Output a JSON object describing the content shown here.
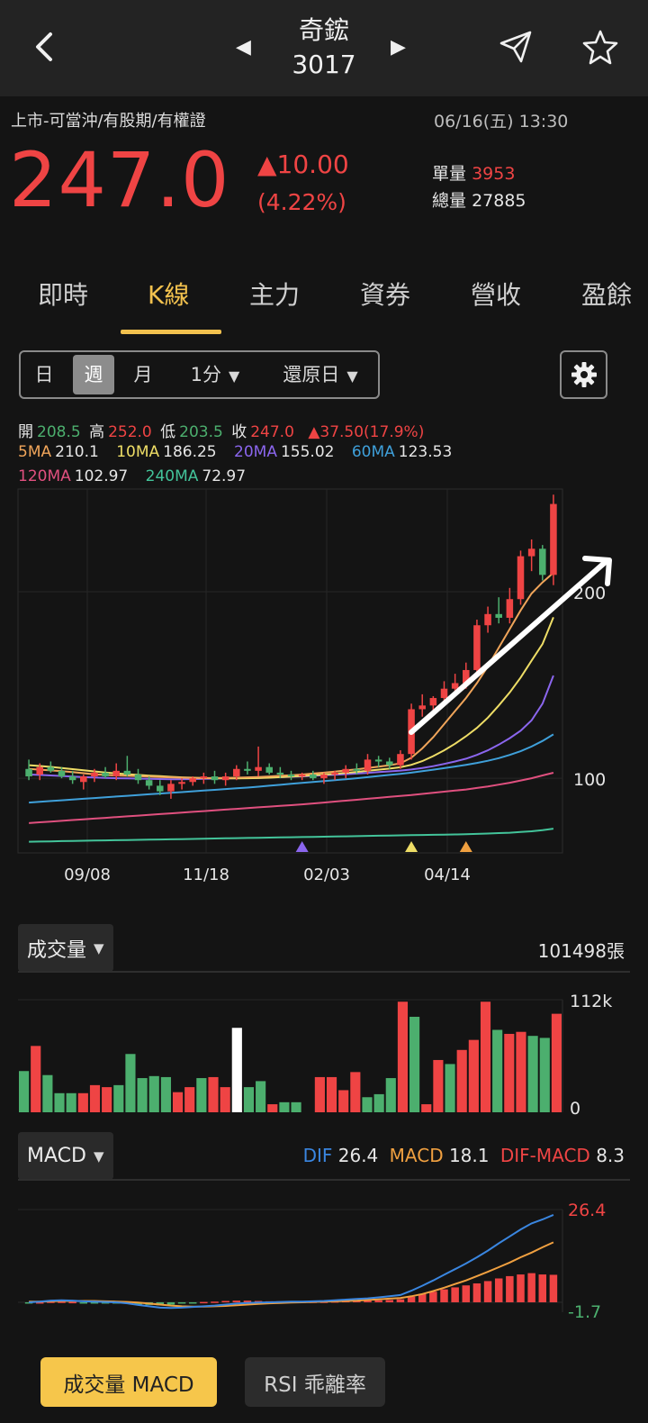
{
  "header": {
    "stock_name": "奇鋐",
    "stock_code": "3017"
  },
  "quote": {
    "market_tags": "上市-可當沖/有股期/有權證",
    "time": "06/16(五) 13:30",
    "price": "247.0",
    "change": "▲10.00",
    "change_pct": "(4.22%)",
    "unit_volume_label": "單量",
    "unit_volume": "3953",
    "total_volume_label": "總量",
    "total_volume": "27885"
  },
  "tabs": [
    "即時",
    "K線",
    "主力",
    "資券",
    "營收",
    "盈餘"
  ],
  "active_tab": "K線",
  "period": {
    "day": "日",
    "week": "週",
    "month": "月",
    "minute": "1分",
    "restore": "還原日"
  },
  "ohlc": {
    "open_label": "開",
    "open": "208.5",
    "high_label": "高",
    "high": "252.0",
    "low_label": "低",
    "low": "203.5",
    "close_label": "收",
    "close": "247.0",
    "change": "▲37.50(17.9%)"
  },
  "ma": {
    "ma5_label": "5MA",
    "ma5": "210.1",
    "ma10_label": "10MA",
    "ma10": "186.25",
    "ma20_label": "20MA",
    "ma20": "155.02",
    "ma60_label": "60MA",
    "ma60": "123.53",
    "ma120_label": "120MA",
    "ma120": "102.97",
    "ma240_label": "240MA",
    "ma240": "72.97"
  },
  "colors": {
    "up": "#ef4444",
    "down": "#4caf6e",
    "accent": "#f2c14e",
    "ma5": "#f0a55a",
    "ma10": "#eedd66",
    "ma20": "#8b66ee",
    "ma60": "#3fa0da",
    "ma120": "#e0507f",
    "ma240": "#43c49a",
    "dif": "#3a86e0",
    "macd": "#f0a040"
  },
  "chart_data": [
    {
      "type": "candlestick",
      "x_ticks": [
        "09/08",
        "11/18",
        "02/03",
        "04/14"
      ],
      "y_ticks": [
        100,
        200
      ],
      "ylim": [
        60,
        255
      ],
      "candles": [
        {
          "o": 105,
          "h": 110,
          "l": 99,
          "c": 101
        },
        {
          "o": 102,
          "h": 108,
          "l": 99,
          "c": 106
        },
        {
          "o": 106,
          "h": 109,
          "l": 103,
          "c": 104
        },
        {
          "o": 104,
          "h": 106,
          "l": 100,
          "c": 101
        },
        {
          "o": 101,
          "h": 104,
          "l": 97,
          "c": 99
        },
        {
          "o": 98,
          "h": 102,
          "l": 94,
          "c": 101
        },
        {
          "o": 101,
          "h": 105,
          "l": 98,
          "c": 103
        },
        {
          "o": 103,
          "h": 106,
          "l": 100,
          "c": 101
        },
        {
          "o": 101,
          "h": 108,
          "l": 99,
          "c": 104
        },
        {
          "o": 104,
          "h": 112,
          "l": 101,
          "c": 102
        },
        {
          "o": 102,
          "h": 105,
          "l": 97,
          "c": 99
        },
        {
          "o": 99,
          "h": 101,
          "l": 94,
          "c": 96
        },
        {
          "o": 96,
          "h": 99,
          "l": 91,
          "c": 93
        },
        {
          "o": 93,
          "h": 99,
          "l": 89,
          "c": 97
        },
        {
          "o": 97,
          "h": 100,
          "l": 94,
          "c": 98
        },
        {
          "o": 98,
          "h": 101,
          "l": 96,
          "c": 100
        },
        {
          "o": 100,
          "h": 103,
          "l": 97,
          "c": 101
        },
        {
          "o": 101,
          "h": 104,
          "l": 97,
          "c": 99
        },
        {
          "o": 99,
          "h": 103,
          "l": 96,
          "c": 101
        },
        {
          "o": 101,
          "h": 107,
          "l": 99,
          "c": 105
        },
        {
          "o": 105,
          "h": 109,
          "l": 102,
          "c": 104
        },
        {
          "o": 104,
          "h": 117,
          "l": 101,
          "c": 106
        },
        {
          "o": 106,
          "h": 108,
          "l": 102,
          "c": 103
        },
        {
          "o": 103,
          "h": 106,
          "l": 100,
          "c": 102
        },
        {
          "o": 102,
          "h": 104,
          "l": 99,
          "c": 101
        },
        {
          "o": 101,
          "h": 103,
          "l": 99,
          "c": 102
        },
        {
          "o": 102,
          "h": 104,
          "l": 99,
          "c": 100
        },
        {
          "o": 100,
          "h": 103,
          "l": 97,
          "c": 102
        },
        {
          "o": 102,
          "h": 104,
          "l": 99,
          "c": 103
        },
        {
          "o": 103,
          "h": 107,
          "l": 100,
          "c": 105
        },
        {
          "o": 105,
          "h": 108,
          "l": 102,
          "c": 104
        },
        {
          "o": 104,
          "h": 113,
          "l": 102,
          "c": 110
        },
        {
          "o": 110,
          "h": 112,
          "l": 106,
          "c": 109
        },
        {
          "o": 109,
          "h": 111,
          "l": 105,
          "c": 107
        },
        {
          "o": 107,
          "h": 115,
          "l": 105,
          "c": 113
        },
        {
          "o": 113,
          "h": 140,
          "l": 110,
          "c": 137
        },
        {
          "o": 137,
          "h": 145,
          "l": 133,
          "c": 139
        },
        {
          "o": 139,
          "h": 144,
          "l": 135,
          "c": 143
        },
        {
          "o": 143,
          "h": 152,
          "l": 140,
          "c": 148
        },
        {
          "o": 148,
          "h": 156,
          "l": 145,
          "c": 151
        },
        {
          "o": 151,
          "h": 162,
          "l": 148,
          "c": 158
        },
        {
          "o": 158,
          "h": 185,
          "l": 156,
          "c": 182
        },
        {
          "o": 182,
          "h": 192,
          "l": 178,
          "c": 188
        },
        {
          "o": 188,
          "h": 197,
          "l": 183,
          "c": 186
        },
        {
          "o": 186,
          "h": 202,
          "l": 183,
          "c": 196
        },
        {
          "o": 196,
          "h": 222,
          "l": 193,
          "c": 219
        },
        {
          "o": 219,
          "h": 228,
          "l": 211,
          "c": 223
        },
        {
          "o": 223,
          "h": 225,
          "l": 206,
          "c": 209
        },
        {
          "o": 209,
          "h": 252,
          "l": 203.5,
          "c": 247
        }
      ],
      "series": [
        {
          "name": "5MA",
          "values": [
            105,
            104.6,
            104.2,
            103.8,
            103.3,
            102.7,
            102.1,
            101.8,
            101.5,
            101.3,
            101.1,
            100.9,
            100.7,
            100.5,
            100.3,
            100.2,
            100.1,
            100.1,
            100.2,
            100.3,
            100.5,
            100.7,
            101.0,
            101.3,
            101.6,
            102.0,
            102.5,
            103.0,
            103.6,
            104.2,
            104.8,
            105.5,
            106.2,
            107.0,
            108.0,
            111.0,
            116.0,
            122.0,
            129.0,
            136.0,
            143.0,
            151.0,
            160.0,
            170.0,
            180.0,
            190.0,
            199.0,
            205.0,
            210.1
          ]
        },
        {
          "name": "10MA",
          "values": [
            107,
            106.6,
            106.1,
            105.5,
            104.9,
            104.3,
            103.7,
            103.1,
            102.6,
            102.2,
            101.8,
            101.4,
            101.1,
            100.8,
            100.5,
            100.3,
            100.1,
            100.0,
            99.9,
            99.9,
            100.0,
            100.1,
            100.3,
            100.6,
            100.9,
            101.2,
            101.6,
            102.0,
            102.4,
            102.9,
            103.4,
            104.0,
            104.6,
            105.2,
            105.9,
            107.2,
            109.2,
            111.9,
            115.0,
            118.5,
            122.5,
            127.0,
            132.5,
            139.0,
            146.0,
            154.0,
            163.0,
            172.0,
            186.25
          ]
        },
        {
          "name": "20MA",
          "values": [
            102,
            101.8,
            101.5,
            101.2,
            100.9,
            100.6,
            100.4,
            100.2,
            100.0,
            99.9,
            99.8,
            99.7,
            99.6,
            99.5,
            99.5,
            99.6,
            99.7,
            99.8,
            99.9,
            100.0,
            100.1,
            100.2,
            100.4,
            100.6,
            100.8,
            101.0,
            101.3,
            101.6,
            101.9,
            102.2,
            102.5,
            102.9,
            103.3,
            103.7,
            104.1,
            104.7,
            105.5,
            106.5,
            107.7,
            109.0,
            110.5,
            112.5,
            115.0,
            118.0,
            121.5,
            125.5,
            131.0,
            140.0,
            155.02
          ]
        },
        {
          "name": "60MA",
          "values": [
            87,
            87.4,
            87.8,
            88.2,
            88.6,
            89.0,
            89.4,
            89.8,
            90.2,
            90.6,
            91.0,
            91.4,
            91.8,
            92.2,
            92.6,
            93.0,
            93.4,
            93.8,
            94.2,
            94.6,
            95.0,
            95.5,
            96.0,
            96.5,
            97.0,
            97.5,
            98.0,
            98.5,
            99.0,
            99.5,
            100.0,
            100.6,
            101.2,
            101.8,
            102.4,
            103.0,
            103.8,
            104.6,
            105.4,
            106.3,
            107.2,
            108.2,
            109.4,
            110.8,
            112.5,
            114.5,
            117.0,
            120.0,
            123.53
          ]
        },
        {
          "name": "120MA",
          "values": [
            76,
            76.4,
            76.8,
            77.2,
            77.6,
            78.0,
            78.4,
            78.8,
            79.2,
            79.6,
            80.0,
            80.4,
            80.8,
            81.2,
            81.6,
            82.0,
            82.4,
            82.8,
            83.2,
            83.6,
            84.0,
            84.4,
            84.8,
            85.2,
            85.6,
            86.0,
            86.5,
            87.0,
            87.5,
            88.0,
            88.5,
            89.0,
            89.5,
            90.0,
            90.5,
            91.0,
            91.6,
            92.2,
            92.8,
            93.4,
            94.0,
            94.8,
            95.6,
            96.6,
            97.6,
            98.8,
            100.0,
            101.5,
            102.97
          ]
        },
        {
          "name": "240MA",
          "values": [
            66,
            66.1,
            66.2,
            66.3,
            66.4,
            66.5,
            66.6,
            66.7,
            66.8,
            66.9,
            67.0,
            67.1,
            67.2,
            67.3,
            67.4,
            67.5,
            67.6,
            67.7,
            67.8,
            67.9,
            68.0,
            68.1,
            68.2,
            68.3,
            68.4,
            68.5,
            68.6,
            68.7,
            68.8,
            68.9,
            69.0,
            69.1,
            69.2,
            69.3,
            69.4,
            69.5,
            69.6,
            69.7,
            69.8,
            69.9,
            70.0,
            70.2,
            70.4,
            70.6,
            70.8,
            71.2,
            71.6,
            72.2,
            72.97
          ]
        }
      ],
      "markers": [
        {
          "index": 25,
          "color": "#8b66ee"
        },
        {
          "index": 35,
          "color": "#eedd66"
        },
        {
          "index": 40,
          "color": "#f0a040"
        }
      ]
    },
    {
      "type": "bar",
      "title": "成交量",
      "total": "101498張",
      "y_ticks": [
        "112k",
        "0"
      ],
      "ylim": [
        0,
        112
      ],
      "values": [
        [
          41,
          "d"
        ],
        [
          66,
          "u"
        ],
        [
          37,
          "d"
        ],
        [
          19,
          "d"
        ],
        [
          19,
          "d"
        ],
        [
          19,
          "u"
        ],
        [
          27,
          "u"
        ],
        [
          25,
          "u"
        ],
        [
          27,
          "d"
        ],
        [
          58,
          "d"
        ],
        [
          34,
          "d"
        ],
        [
          36,
          "d"
        ],
        [
          35,
          "d"
        ],
        [
          20,
          "u"
        ],
        [
          25,
          "u"
        ],
        [
          34,
          "d"
        ],
        [
          35,
          "u"
        ],
        [
          25,
          "u"
        ],
        [
          84,
          "w"
        ],
        [
          25,
          "d"
        ],
        [
          31,
          "d"
        ],
        [
          8,
          "u"
        ],
        [
          10,
          "d"
        ],
        [
          10,
          "d"
        ],
        [
          0,
          "d"
        ],
        [
          35,
          "u"
        ],
        [
          35,
          "u"
        ],
        [
          22,
          "u"
        ],
        [
          40,
          "u"
        ],
        [
          15,
          "d"
        ],
        [
          18,
          "d"
        ],
        [
          34,
          "d"
        ],
        [
          110,
          "u"
        ],
        [
          95,
          "d"
        ],
        [
          8,
          "u"
        ],
        [
          52,
          "u"
        ],
        [
          48,
          "d"
        ],
        [
          62,
          "u"
        ],
        [
          72,
          "u"
        ],
        [
          110,
          "u"
        ],
        [
          82,
          "d"
        ],
        [
          78,
          "u"
        ],
        [
          80,
          "u"
        ],
        [
          76,
          "d"
        ],
        [
          74,
          "d"
        ],
        [
          98,
          "u"
        ]
      ]
    },
    {
      "type": "line",
      "title": "MACD",
      "dif_label": "DIF",
      "dif": "26.4",
      "macd_label": "MACD",
      "macd": "18.1",
      "osc_label": "DIF-MACD",
      "osc": "8.3",
      "y_ticks": [
        "26.4",
        "-1.7"
      ],
      "ylim": [
        -3,
        28
      ],
      "dif_values": [
        0.0,
        0.2,
        0.5,
        0.6,
        0.5,
        0.3,
        0.2,
        0.1,
        0.0,
        -0.3,
        -0.8,
        -1.2,
        -1.6,
        -1.7,
        -1.6,
        -1.4,
        -1.2,
        -1.0,
        -0.7,
        -0.4,
        -0.2,
        -0.1,
        0.0,
        0.1,
        0.2,
        0.2,
        0.3,
        0.4,
        0.6,
        0.8,
        1.0,
        1.2,
        1.5,
        1.8,
        2.2,
        3.5,
        5.0,
        6.6,
        8.3,
        10.0,
        11.7,
        13.6,
        15.6,
        17.8,
        19.9,
        22.0,
        23.8,
        25.0,
        26.4
      ],
      "macd_values": [
        0.2,
        0.2,
        0.3,
        0.4,
        0.4,
        0.4,
        0.4,
        0.3,
        0.2,
        0.1,
        -0.1,
        -0.4,
        -0.7,
        -1.0,
        -1.2,
        -1.3,
        -1.3,
        -1.2,
        -1.1,
        -0.9,
        -0.7,
        -0.5,
        -0.3,
        -0.2,
        -0.1,
        0.0,
        0.1,
        0.2,
        0.3,
        0.4,
        0.5,
        0.7,
        0.9,
        1.1,
        1.3,
        1.8,
        2.5,
        3.4,
        4.4,
        5.5,
        6.6,
        7.9,
        9.2,
        10.6,
        12.0,
        13.6,
        15.0,
        16.6,
        18.1
      ],
      "osc_values": [
        -0.2,
        0.0,
        0.2,
        0.2,
        0.1,
        -0.1,
        -0.2,
        -0.2,
        -0.2,
        -0.4,
        -0.7,
        -0.8,
        -0.9,
        -0.7,
        -0.4,
        -0.1,
        0.1,
        0.2,
        0.4,
        0.5,
        0.5,
        0.4,
        0.3,
        0.3,
        0.3,
        0.2,
        0.2,
        0.2,
        0.3,
        0.4,
        0.5,
        0.5,
        0.6,
        0.7,
        0.9,
        1.7,
        2.5,
        3.2,
        3.9,
        4.5,
        5.1,
        5.7,
        6.4,
        7.2,
        7.9,
        8.4,
        8.8,
        8.4,
        8.3
      ]
    }
  ],
  "volume_section": {
    "label": "成交量"
  },
  "macd_section": {
    "label": "MACD"
  },
  "bottom": {
    "btn1": "成交量 MACD",
    "btn2": "RSI 乖離率"
  }
}
